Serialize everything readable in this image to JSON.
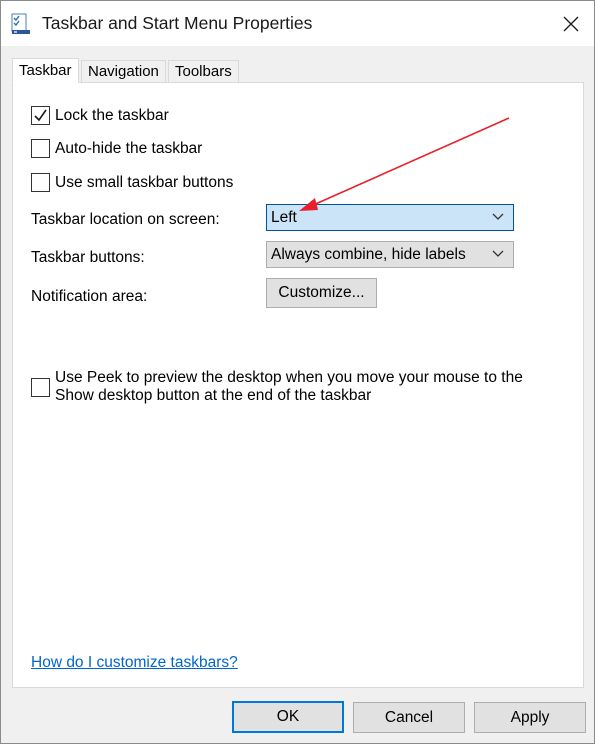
{
  "window": {
    "title": "Taskbar and Start Menu Properties"
  },
  "tabs": [
    {
      "label": "Taskbar",
      "active": true
    },
    {
      "label": "Navigation",
      "active": false
    },
    {
      "label": "Toolbars",
      "active": false
    }
  ],
  "taskbar": {
    "lock": {
      "label": "Lock the taskbar",
      "checked": true
    },
    "autohide": {
      "label": "Auto-hide the taskbar",
      "checked": false
    },
    "small_buttons": {
      "label": "Use small taskbar buttons",
      "checked": false
    },
    "location": {
      "label": "Taskbar location on screen:",
      "value": "Left"
    },
    "buttons": {
      "label": "Taskbar buttons:",
      "value": "Always combine, hide labels"
    },
    "notification": {
      "label": "Notification area:",
      "button": "Customize..."
    },
    "peek": {
      "line1": "Use Peek to preview the desktop when you move your mouse to the",
      "line2": "Show desktop button at the end of the taskbar",
      "checked": false
    },
    "help_link": "How do I customize taskbars?"
  },
  "footer": {
    "ok": "OK",
    "cancel": "Cancel",
    "apply": "Apply"
  },
  "colors": {
    "accent": "#0078d7",
    "link": "#0066cc",
    "annotation_arrow": "#e8202a",
    "combo_focused_bg": "#cce4f7"
  },
  "icons": {
    "window": "taskbar-properties-icon",
    "close": "close-icon",
    "combo": "chevron-down-icon",
    "check": "checkmark-icon"
  }
}
